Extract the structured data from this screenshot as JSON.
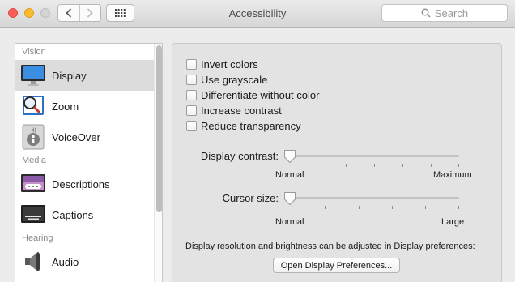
{
  "window": {
    "title": "Accessibility"
  },
  "toolbar": {
    "back_icon": "chevron-left-icon",
    "forward_icon": "chevron-right-icon",
    "grid_icon": "grid-icon"
  },
  "search": {
    "placeholder": "Search"
  },
  "sidebar": {
    "sections": [
      {
        "title": "Vision",
        "items": [
          {
            "label": "Display",
            "icon": "display-icon",
            "selected": true
          },
          {
            "label": "Zoom",
            "icon": "zoom-icon",
            "selected": false
          },
          {
            "label": "VoiceOver",
            "icon": "voiceover-icon",
            "selected": false
          }
        ]
      },
      {
        "title": "Media",
        "items": [
          {
            "label": "Descriptions",
            "icon": "descriptions-icon",
            "selected": false
          },
          {
            "label": "Captions",
            "icon": "captions-icon",
            "selected": false
          }
        ]
      },
      {
        "title": "Hearing",
        "items": [
          {
            "label": "Audio",
            "icon": "speaker-icon",
            "selected": false
          }
        ]
      }
    ]
  },
  "options": [
    {
      "label": "Invert colors",
      "checked": false
    },
    {
      "label": "Use grayscale",
      "checked": false
    },
    {
      "label": "Differentiate without color",
      "checked": false
    },
    {
      "label": "Increase contrast",
      "checked": false
    },
    {
      "label": "Reduce transparency",
      "checked": false
    }
  ],
  "sliders": {
    "contrast": {
      "label": "Display contrast:",
      "min_label": "Normal",
      "max_label": "Maximum",
      "value": 0
    },
    "cursor": {
      "label": "Cursor size:",
      "min_label": "Normal",
      "max_label": "Large",
      "value": 0
    }
  },
  "footer": {
    "note": "Display resolution and brightness can be adjusted in Display preferences:",
    "button_label": "Open Display Preferences..."
  },
  "colors": {
    "selected_row": "#dcdcdc",
    "close": "#fc5f57",
    "minimize": "#fdbc2e"
  }
}
